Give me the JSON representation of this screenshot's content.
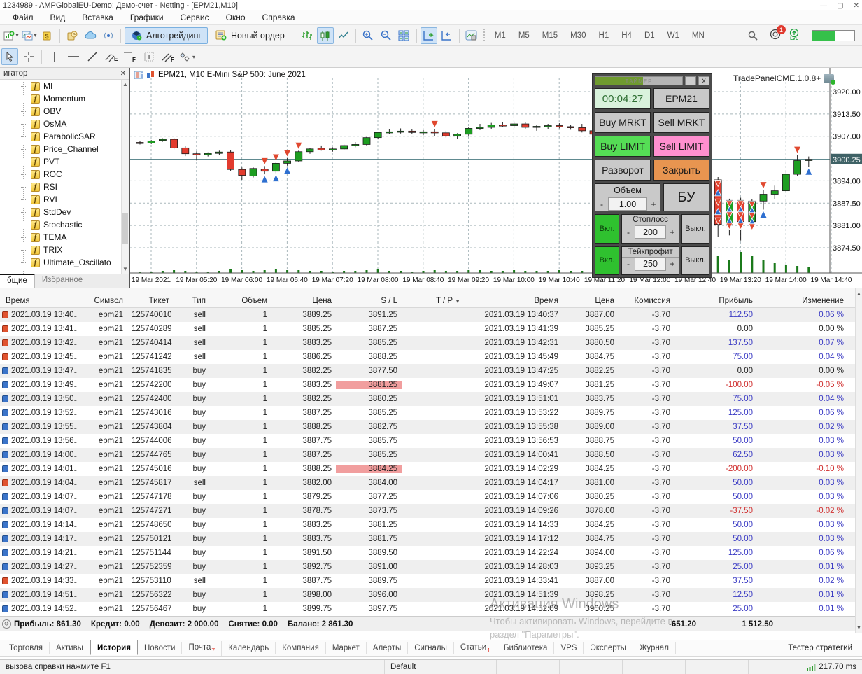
{
  "window": {
    "title": "1234989 - AMPGlobalEU-Demo: Демо-счет - Netting - [EPM21,M10]",
    "controls": {
      "minimize": "—",
      "maximize": "▢",
      "close": "✕"
    }
  },
  "menu": [
    "Файл",
    "Вид",
    "Вставка",
    "Графики",
    "Сервис",
    "Окно",
    "Справка"
  ],
  "toolbar": {
    "algo_label": "Алготрейдинг",
    "new_order_label": "Новый ордер",
    "timeframes": [
      "M1",
      "M5",
      "M15",
      "M30",
      "H1",
      "H4",
      "D1",
      "W1",
      "MN"
    ],
    "notification_count": "1",
    "lvl_label": "LVL"
  },
  "navigator": {
    "title": "игатор",
    "close": "✕",
    "items": [
      "MI",
      "Momentum",
      "OBV",
      "OsMA",
      "ParabolicSAR",
      "Price_Channel",
      "PVT",
      "ROC",
      "RSI",
      "RVI",
      "StdDev",
      "Stochastic",
      "TEMA",
      "TRIX",
      "Ultimate_Oscillato"
    ],
    "tabs": [
      "бщие",
      "Избранное"
    ]
  },
  "chart_data": {
    "type": "candlestick",
    "title": "EPM21, M10  E-Mini S&P 500: June 2021",
    "symbol": "EPM21",
    "period": "M10",
    "current_price": 3900.25,
    "y_axis": [
      3920.0,
      3913.5,
      3907.0,
      3900.25,
      3894.0,
      3887.5,
      3881.0,
      3874.5
    ],
    "x_labels": [
      "19 Mar 2021",
      "19 Mar 05:20",
      "19 Mar 06:00",
      "19 Mar 06:40",
      "19 Mar 07:20",
      "19 Mar 08:00",
      "19 Mar 08:40",
      "19 Mar 09:20",
      "19 Mar 10:00",
      "19 Mar 10:40",
      "19 Mar 11:20",
      "19 Mar 12:00",
      "19 Mar 12:40",
      "19 Mar 13:20",
      "19 Mar 14:00",
      "19 Mar 14:40"
    ],
    "colors": {
      "up": "#1d9e21",
      "down": "#e23b2e",
      "wick": "#222222",
      "grid": "#a9b7bb",
      "bid_line": "#4a7a80",
      "volume": "#1b7a1b",
      "arrow_up": "#2e6fd0",
      "arrow_down": "#e0482f"
    },
    "candles": [
      [
        3905.2,
        3905.6,
        3904.6,
        3905.0
      ],
      [
        3905.0,
        3905.9,
        3904.7,
        3905.6
      ],
      [
        3905.8,
        3906.4,
        3905.4,
        3906.1
      ],
      [
        3906.1,
        3906.5,
        3903.2,
        3903.6
      ],
      [
        3903.6,
        3904.1,
        3901.2,
        3901.9
      ],
      [
        3901.9,
        3902.6,
        3899.9,
        3901.6
      ],
      [
        3901.6,
        3902.3,
        3901.1,
        3902.0
      ],
      [
        3902.0,
        3902.8,
        3901.5,
        3902.4
      ],
      [
        3902.4,
        3902.9,
        3896.8,
        3897.3
      ],
      [
        3897.3,
        3897.9,
        3894.3,
        3895.6
      ],
      [
        3895.4,
        3897.9,
        3895.0,
        3897.6
      ],
      [
        3897.4,
        3898.3,
        3895.9,
        3896.8,
        "du"
      ],
      [
        3896.8,
        3899.4,
        3896.2,
        3899.1,
        "du"
      ],
      [
        3899.1,
        3900.6,
        3898.4,
        3899.8,
        "du"
      ],
      [
        3899.8,
        3902.8,
        3899.4,
        3902.5,
        "d"
      ],
      [
        3902.5,
        3903.6,
        3901.9,
        3903.3
      ],
      [
        3903.5,
        3904.3,
        3902.8,
        3903.0
      ],
      [
        3903.0,
        3903.8,
        3902.5,
        3903.3
      ],
      [
        3903.3,
        3904.6,
        3903.0,
        3904.3
      ],
      [
        3904.3,
        3905.3,
        3903.8,
        3904.6
      ],
      [
        3904.6,
        3906.8,
        3904.3,
        3906.6
      ],
      [
        3906.6,
        3908.3,
        3906.1,
        3908.1
      ],
      [
        3908.1,
        3909.0,
        3907.6,
        3908.3
      ],
      [
        3908.3,
        3909.3,
        3907.8,
        3908.5
      ],
      [
        3908.5,
        3909.1,
        3907.6,
        3908.1
      ],
      [
        3908.1,
        3908.8,
        3907.3,
        3908.3
      ],
      [
        3908.3,
        3909.1,
        3907.1,
        3908.0,
        "d"
      ],
      [
        3908.0,
        3908.6,
        3906.6,
        3907.1
      ],
      [
        3907.1,
        3907.9,
        3906.3,
        3907.6
      ],
      [
        3907.6,
        3909.6,
        3907.1,
        3909.3
      ],
      [
        3909.3,
        3910.6,
        3908.8,
        3909.6
      ],
      [
        3909.6,
        3910.9,
        3909.1,
        3910.3
      ],
      [
        3910.3,
        3911.1,
        3909.6,
        3910.1
      ],
      [
        3910.1,
        3911.3,
        3909.4,
        3910.6
      ],
      [
        3910.6,
        3911.1,
        3909.1,
        3909.6
      ],
      [
        3909.6,
        3910.3,
        3908.6,
        3909.9
      ],
      [
        3909.9,
        3910.6,
        3909.1,
        3910.1
      ],
      [
        3910.1,
        3910.8,
        3909.3,
        3909.8
      ],
      [
        3909.8,
        3910.4,
        3908.9,
        3909.5
      ],
      [
        3909.5,
        3910.6,
        3908.1,
        3908.6
      ],
      [
        3908.6,
        3909.3,
        3907.1,
        3907.6
      ],
      [
        3907.6,
        3908.1,
        3905.1,
        3905.6
      ],
      [
        3905.6,
        3906.3,
        3902.6,
        3903.1
      ],
      [
        3903.1,
        3904.1,
        3900.6,
        3901.1
      ],
      [
        3901.1,
        3902.1,
        3898.6,
        3899.1
      ],
      [
        3899.1,
        3901.6,
        3898.6,
        3901.1
      ],
      [
        3901.1,
        3904.6,
        3900.6,
        3904.1
      ],
      [
        3904.1,
        3907.1,
        3903.6,
        3906.6
      ],
      [
        3906.6,
        3908.1,
        3905.6,
        3907.6
      ],
      [
        3907.6,
        3908.1,
        3899.1,
        3899.8
      ],
      [
        3899.8,
        3902.1,
        3892.1,
        3894.1,
        "m"
      ],
      [
        3894.3,
        3895.1,
        3877.6,
        3881.3,
        "m"
      ],
      [
        3881.3,
        3888.8,
        3878.1,
        3888.3,
        "m"
      ],
      [
        3888.3,
        3889.1,
        3876.6,
        3882.1,
        "m"
      ],
      [
        3882.1,
        3888.6,
        3880.6,
        3888.1,
        "m"
      ],
      [
        3888.1,
        3891.3,
        3885.6,
        3890.1,
        "du"
      ],
      [
        3890.1,
        3892.6,
        3888.6,
        3891.1
      ],
      [
        3891.1,
        3896.6,
        3890.6,
        3895.9
      ],
      [
        3895.9,
        3901.6,
        3895.4,
        3899.9,
        "d"
      ],
      [
        3899.9,
        3901.1,
        3898.1,
        3900.25,
        "u"
      ]
    ],
    "volumes": [
      2,
      2,
      3,
      4,
      3,
      2,
      2,
      3,
      5,
      4,
      3,
      4,
      5,
      4,
      4,
      3,
      3,
      2,
      3,
      3,
      4,
      5,
      3,
      3,
      2,
      3,
      4,
      3,
      3,
      4,
      4,
      3,
      3,
      4,
      3,
      3,
      3,
      4,
      3,
      3,
      4,
      5,
      6,
      7,
      7,
      8,
      9,
      8,
      10,
      12,
      26,
      24,
      19,
      30,
      24,
      19,
      14,
      12,
      10,
      8
    ]
  },
  "trade_panel": {
    "caption": "TradePanelCME.1.0.8+",
    "timer_bar_label": "ТАЙМЕР",
    "minimize": "",
    "close": "X",
    "timer": "00:04:27",
    "symbol": "EPM21",
    "buy_mrkt": "Buy MRKT",
    "sell_mrkt": "Sell MRKT",
    "buy_limit": "Buy LIMIT",
    "sell_limit": "Sell LIMIT",
    "reverse": "Разворот",
    "close_btn": "Закрыть",
    "volume_label": "Объем",
    "volume_value": "1.00",
    "be_label": "БУ",
    "minus": "-",
    "plus": "+",
    "on_label": "Вкл.",
    "off_label": "Выкл.",
    "stoploss_label": "Стоплосс",
    "stoploss_value": "200",
    "takeprofit_label": "Тейкпрофит",
    "takeprofit_value": "250"
  },
  "history": {
    "columns": [
      "Время",
      "Символ",
      "Тикет",
      "Тип",
      "Объем",
      "Цена",
      "S / L",
      "T / P",
      "Время",
      "Цена",
      "Комиссия",
      "Прибыль",
      "Изменение"
    ],
    "rows": [
      {
        "type": "sell",
        "time": "2021.03.19 13:40...",
        "symbol": "epm21",
        "ticket": "125740010",
        "vol": "1",
        "price": "3889.25",
        "sl": "3891.25",
        "slh": false,
        "time2": "2021.03.19 13:40:37",
        "price2": "3887.00",
        "com": "-3.70",
        "profit": "112.50",
        "pc": "pos",
        "chg": "0.06 %"
      },
      {
        "type": "sell",
        "time": "2021.03.19 13:41...",
        "symbol": "epm21",
        "ticket": "125740289",
        "vol": "1",
        "price": "3885.25",
        "sl": "3887.25",
        "slh": false,
        "time2": "2021.03.19 13:41:39",
        "price2": "3885.25",
        "com": "-3.70",
        "profit": "0.00",
        "pc": "zero",
        "chg": "0.00 %"
      },
      {
        "type": "sell",
        "time": "2021.03.19 13:42...",
        "symbol": "epm21",
        "ticket": "125740414",
        "vol": "1",
        "price": "3883.25",
        "sl": "3885.25",
        "slh": false,
        "time2": "2021.03.19 13:42:31",
        "price2": "3880.50",
        "com": "-3.70",
        "profit": "137.50",
        "pc": "pos",
        "chg": "0.07 %"
      },
      {
        "type": "sell",
        "time": "2021.03.19 13:45...",
        "symbol": "epm21",
        "ticket": "125741242",
        "vol": "1",
        "price": "3886.25",
        "sl": "3888.25",
        "slh": false,
        "time2": "2021.03.19 13:45:49",
        "price2": "3884.75",
        "com": "-3.70",
        "profit": "75.00",
        "pc": "pos",
        "chg": "0.04 %"
      },
      {
        "type": "buy",
        "time": "2021.03.19 13:47...",
        "symbol": "epm21",
        "ticket": "125741835",
        "vol": "1",
        "price": "3882.25",
        "sl": "3877.50",
        "slh": false,
        "time2": "2021.03.19 13:47:25",
        "price2": "3882.25",
        "com": "-3.70",
        "profit": "0.00",
        "pc": "zero",
        "chg": "0.00 %"
      },
      {
        "type": "buy",
        "time": "2021.03.19 13:49...",
        "symbol": "epm21",
        "ticket": "125742200",
        "vol": "1",
        "price": "3883.25",
        "sl": "3881.25",
        "slh": true,
        "time2": "2021.03.19 13:49:07",
        "price2": "3881.25",
        "com": "-3.70",
        "profit": "-100.00",
        "pc": "neg",
        "chg": "-0.05 %"
      },
      {
        "type": "buy",
        "time": "2021.03.19 13:50...",
        "symbol": "epm21",
        "ticket": "125742400",
        "vol": "1",
        "price": "3882.25",
        "sl": "3880.25",
        "slh": false,
        "time2": "2021.03.19 13:51:01",
        "price2": "3883.75",
        "com": "-3.70",
        "profit": "75.00",
        "pc": "pos",
        "chg": "0.04 %"
      },
      {
        "type": "buy",
        "time": "2021.03.19 13:52...",
        "symbol": "epm21",
        "ticket": "125743016",
        "vol": "1",
        "price": "3887.25",
        "sl": "3885.25",
        "slh": false,
        "time2": "2021.03.19 13:53:22",
        "price2": "3889.75",
        "com": "-3.70",
        "profit": "125.00",
        "pc": "pos",
        "chg": "0.06 %"
      },
      {
        "type": "buy",
        "time": "2021.03.19 13:55...",
        "symbol": "epm21",
        "ticket": "125743804",
        "vol": "1",
        "price": "3888.25",
        "sl": "3882.75",
        "slh": false,
        "time2": "2021.03.19 13:55:38",
        "price2": "3889.00",
        "com": "-3.70",
        "profit": "37.50",
        "pc": "pos",
        "chg": "0.02 %"
      },
      {
        "type": "buy",
        "time": "2021.03.19 13:56...",
        "symbol": "epm21",
        "ticket": "125744006",
        "vol": "1",
        "price": "3887.75",
        "sl": "3885.75",
        "slh": false,
        "time2": "2021.03.19 13:56:53",
        "price2": "3888.75",
        "com": "-3.70",
        "profit": "50.00",
        "pc": "pos",
        "chg": "0.03 %"
      },
      {
        "type": "buy",
        "time": "2021.03.19 14:00...",
        "symbol": "epm21",
        "ticket": "125744765",
        "vol": "1",
        "price": "3887.25",
        "sl": "3885.25",
        "slh": false,
        "time2": "2021.03.19 14:00:41",
        "price2": "3888.50",
        "com": "-3.70",
        "profit": "62.50",
        "pc": "pos",
        "chg": "0.03 %"
      },
      {
        "type": "buy",
        "time": "2021.03.19 14:01...",
        "symbol": "epm21",
        "ticket": "125745016",
        "vol": "1",
        "price": "3888.25",
        "sl": "3884.25",
        "slh": true,
        "time2": "2021.03.19 14:02:29",
        "price2": "3884.25",
        "com": "-3.70",
        "profit": "-200.00",
        "pc": "neg",
        "chg": "-0.10 %"
      },
      {
        "type": "sell",
        "time": "2021.03.19 14:04...",
        "symbol": "epm21",
        "ticket": "125745817",
        "vol": "1",
        "price": "3882.00",
        "sl": "3884.00",
        "slh": false,
        "time2": "2021.03.19 14:04:17",
        "price2": "3881.00",
        "com": "-3.70",
        "profit": "50.00",
        "pc": "pos",
        "chg": "0.03 %"
      },
      {
        "type": "buy",
        "time": "2021.03.19 14:07...",
        "symbol": "epm21",
        "ticket": "125747178",
        "vol": "1",
        "price": "3879.25",
        "sl": "3877.25",
        "slh": false,
        "time2": "2021.03.19 14:07:06",
        "price2": "3880.25",
        "com": "-3.70",
        "profit": "50.00",
        "pc": "pos",
        "chg": "0.03 %"
      },
      {
        "type": "buy",
        "time": "2021.03.19 14:07...",
        "symbol": "epm21",
        "ticket": "125747271",
        "vol": "1",
        "price": "3878.75",
        "sl": "3873.75",
        "slh": false,
        "time2": "2021.03.19 14:09:26",
        "price2": "3878.00",
        "com": "-3.70",
        "profit": "-37.50",
        "pc": "neg",
        "chg": "-0.02 %"
      },
      {
        "type": "buy",
        "time": "2021.03.19 14:14...",
        "symbol": "epm21",
        "ticket": "125748650",
        "vol": "1",
        "price": "3883.25",
        "sl": "3881.25",
        "slh": false,
        "time2": "2021.03.19 14:14:33",
        "price2": "3884.25",
        "com": "-3.70",
        "profit": "50.00",
        "pc": "pos",
        "chg": "0.03 %"
      },
      {
        "type": "buy",
        "time": "2021.03.19 14:17...",
        "symbol": "epm21",
        "ticket": "125750121",
        "vol": "1",
        "price": "3883.75",
        "sl": "3881.75",
        "slh": false,
        "time2": "2021.03.19 14:17:12",
        "price2": "3884.75",
        "com": "-3.70",
        "profit": "50.00",
        "pc": "pos",
        "chg": "0.03 %"
      },
      {
        "type": "buy",
        "time": "2021.03.19 14:21...",
        "symbol": "epm21",
        "ticket": "125751144",
        "vol": "1",
        "price": "3891.50",
        "sl": "3889.50",
        "slh": false,
        "time2": "2021.03.19 14:22:24",
        "price2": "3894.00",
        "com": "-3.70",
        "profit": "125.00",
        "pc": "pos",
        "chg": "0.06 %"
      },
      {
        "type": "buy",
        "time": "2021.03.19 14:27...",
        "symbol": "epm21",
        "ticket": "125752359",
        "vol": "1",
        "price": "3892.75",
        "sl": "3891.00",
        "slh": false,
        "time2": "2021.03.19 14:28:03",
        "price2": "3893.25",
        "com": "-3.70",
        "profit": "25.00",
        "pc": "pos",
        "chg": "0.01 %"
      },
      {
        "type": "sell",
        "time": "2021.03.19 14:33...",
        "symbol": "epm21",
        "ticket": "125753110",
        "vol": "1",
        "price": "3887.75",
        "sl": "3889.75",
        "slh": false,
        "time2": "2021.03.19 14:33:41",
        "price2": "3887.00",
        "com": "-3.70",
        "profit": "37.50",
        "pc": "pos",
        "chg": "0.02 %"
      },
      {
        "type": "buy",
        "time": "2021.03.19 14:51...",
        "symbol": "epm21",
        "ticket": "125756322",
        "vol": "1",
        "price": "3898.00",
        "sl": "3896.00",
        "slh": false,
        "time2": "2021.03.19 14:51:39",
        "price2": "3898.25",
        "com": "-3.70",
        "profit": "12.50",
        "pc": "pos",
        "chg": "0.01 %"
      },
      {
        "type": "buy",
        "time": "2021.03.19 14:52...",
        "symbol": "epm21",
        "ticket": "125756467",
        "vol": "1",
        "price": "3899.75",
        "sl": "3897.75",
        "slh": false,
        "time2": "2021.03.19 14:52:09",
        "price2": "3900.25",
        "com": "-3.70",
        "profit": "25.00",
        "pc": "pos",
        "chg": "0.01 %"
      }
    ],
    "summary": {
      "profit": "Прибыль: 861.30",
      "credit": "Кредит: 0.00",
      "deposit": "Депозит: 2 000.00",
      "withdrawal": "Снятие: 0.00",
      "balance": "Баланс: 2 861.30",
      "total_commission": "-651.20",
      "total_profit": "1 512.50"
    }
  },
  "watermark": {
    "line1": "Активация Windows",
    "line2": "Чтобы активировать Windows, перейдите в раздел \"Параметры\"."
  },
  "bottom_tabs": [
    {
      "label": "Торговля"
    },
    {
      "label": "Активы"
    },
    {
      "label": "История",
      "active": true
    },
    {
      "label": "Новости"
    },
    {
      "label": "Почта",
      "badge": "7"
    },
    {
      "label": "Календарь"
    },
    {
      "label": "Компания"
    },
    {
      "label": "Маркет"
    },
    {
      "label": "Алерты"
    },
    {
      "label": "Сигналы"
    },
    {
      "label": "Статьи",
      "badge": "1"
    },
    {
      "label": "Библиотека"
    },
    {
      "label": "VPS"
    },
    {
      "label": "Эксперты"
    },
    {
      "label": "Журнал"
    }
  ],
  "tester_label": "Тестер стратегий",
  "status_bar": {
    "help": "вызова справки нажмите F1",
    "profile": "Default",
    "ping": "217.70 ms"
  }
}
